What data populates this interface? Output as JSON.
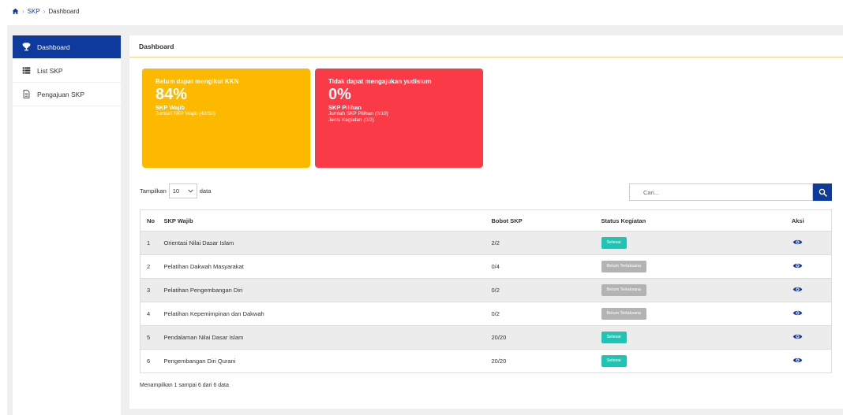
{
  "breadcrumb": {
    "link": "SKP",
    "current": "Dashboard"
  },
  "sidebar": {
    "items": [
      {
        "label": "Dashboard"
      },
      {
        "label": "List SKP"
      },
      {
        "label": "Pengajuan SKP"
      }
    ]
  },
  "panel": {
    "title": "Dashboard"
  },
  "cards": [
    {
      "title": "Belum dapat mengikut KKN",
      "value": "84%",
      "subtitle": "SKP Wajib",
      "lines": [
        "Jumlah SKP Wajib (42/50)"
      ],
      "color": "#fcb900"
    },
    {
      "title": "Tidak dapat mengajukan yudisium",
      "value": "0%",
      "subtitle": "SKP Pilihan",
      "lines": [
        "Jumlah SKP Pilihan (0/10)",
        "Jenis Kegiatan (0/2)"
      ],
      "color": "#fa3b47"
    }
  ],
  "length_menu": {
    "prefix": "Tampilkan",
    "value": "10",
    "suffix": "data"
  },
  "search": {
    "placeholder": "Cari..."
  },
  "table": {
    "headers": {
      "no": "No",
      "name": "SKP Wajib",
      "bobot": "Bobot SKP",
      "status": "Status Kegiatan",
      "aksi": "Aksi"
    },
    "rows": [
      {
        "no": "1",
        "name": "Orientasi Nilai Dasar Islam",
        "bobot": "2/2",
        "status": "Selesai",
        "done": true
      },
      {
        "no": "2",
        "name": "Pelatihan Dakwah Masyarakat",
        "bobot": "0/4",
        "status": "Belum Terlaksana",
        "done": false
      },
      {
        "no": "3",
        "name": "Pelatihan Pengembangan Diri",
        "bobot": "0/2",
        "status": "Belum Terlaksana",
        "done": false
      },
      {
        "no": "4",
        "name": "Pelatihan Kepemimpinan dan Dakwah",
        "bobot": "0/2",
        "status": "Belum Terlaksana",
        "done": false
      },
      {
        "no": "5",
        "name": "Pendalaman Nilai Dasar Islam",
        "bobot": "20/20",
        "status": "Selesai",
        "done": true
      },
      {
        "no": "6",
        "name": "Pengembangan Diri Qurani",
        "bobot": "20/20",
        "status": "Selesai",
        "done": true
      }
    ]
  },
  "info": "Menampilkan 1 sampai 6 dari 6 data",
  "colors": {
    "primary": "#0d3a9c",
    "success": "#1dc6b4",
    "muted": "#b3b3b3"
  },
  "icons": {
    "breadcrumb": "home-icon",
    "dashboard": "trophy-icon",
    "list": "list-icon",
    "pengajuan": "document-icon",
    "search": "search-icon",
    "aksi": "eye-icon"
  }
}
